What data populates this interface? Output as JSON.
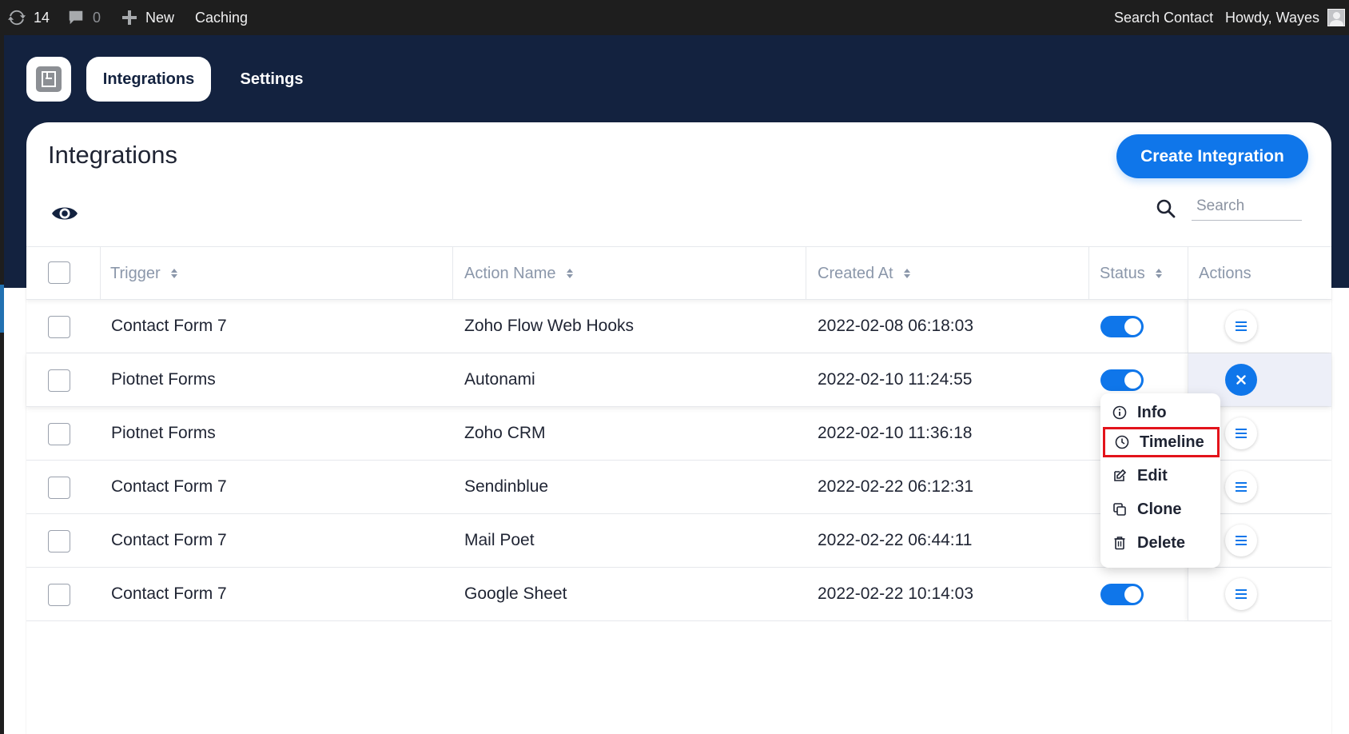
{
  "adminbar": {
    "updates_count": "14",
    "comments_count": "0",
    "new_label": "New",
    "caching_label": "Caching",
    "search_contact_label": "Search Contact",
    "howdy_label": "Howdy, Wayes"
  },
  "header": {
    "tabs": [
      {
        "label": "Integrations",
        "active": true
      },
      {
        "label": "Settings",
        "active": false
      }
    ]
  },
  "main": {
    "title": "Integrations",
    "create_button_label": "Create Integration",
    "search_placeholder": "Search"
  },
  "table": {
    "columns": [
      "Trigger",
      "Action Name",
      "Created At",
      "Status",
      "Actions"
    ],
    "rows": [
      {
        "trigger": "Contact Form 7",
        "action_name": "Zoho Flow Web Hooks",
        "created_at": "2022-02-08 06:18:03",
        "status": true
      },
      {
        "trigger": "Piotnet Forms",
        "action_name": "Autonami",
        "created_at": "2022-02-10 11:24:55",
        "status": true
      },
      {
        "trigger": "Piotnet Forms",
        "action_name": "Zoho CRM",
        "created_at": "2022-02-10 11:36:18",
        "status": true
      },
      {
        "trigger": "Contact Form 7",
        "action_name": "Sendinblue",
        "created_at": "2022-02-22 06:12:31",
        "status": true
      },
      {
        "trigger": "Contact Form 7",
        "action_name": "Mail Poet",
        "created_at": "2022-02-22 06:44:11",
        "status": true
      },
      {
        "trigger": "Contact Form 7",
        "action_name": "Google Sheet",
        "created_at": "2022-02-22 10:14:03",
        "status": true
      }
    ]
  },
  "actions_menu": {
    "items": [
      {
        "label": "Info",
        "icon": "info-icon"
      },
      {
        "label": "Timeline",
        "icon": "clock-icon",
        "selected": true
      },
      {
        "label": "Edit",
        "icon": "edit-icon"
      },
      {
        "label": "Clone",
        "icon": "clone-icon"
      },
      {
        "label": "Delete",
        "icon": "trash-icon"
      }
    ]
  },
  "colors": {
    "brand_blue": "#0f76ea",
    "navy": "#13223f",
    "admin_bar": "#1e1e1e",
    "highlight_red": "#e3131b"
  }
}
